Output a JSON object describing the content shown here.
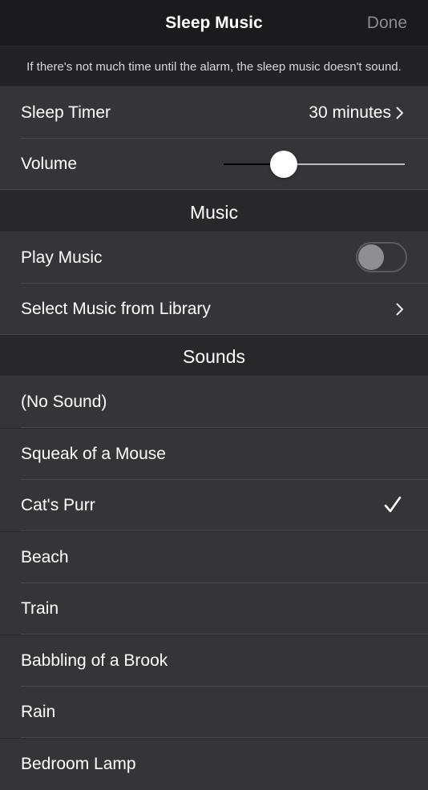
{
  "nav": {
    "title": "Sleep Music",
    "done_label": "Done"
  },
  "notice": "If there's not much time until the alarm, the sleep music doesn't sound.",
  "settings": {
    "sleep_timer_label": "Sleep Timer",
    "sleep_timer_value": "30 minutes",
    "volume_label": "Volume",
    "volume_level": 0.33
  },
  "music": {
    "header": "Music",
    "play_music_label": "Play Music",
    "play_music_on": false,
    "select_library_label": "Select Music from Library"
  },
  "sounds": {
    "header": "Sounds",
    "items": [
      {
        "label": "(No Sound)",
        "selected": false
      },
      {
        "label": "Squeak of a Mouse",
        "selected": false
      },
      {
        "label": "Cat's Purr",
        "selected": true
      },
      {
        "label": "Beach",
        "selected": false
      },
      {
        "label": "Train",
        "selected": false
      },
      {
        "label": "Babbling of a Brook",
        "selected": false
      },
      {
        "label": "Rain",
        "selected": false
      },
      {
        "label": "Bedroom Lamp",
        "selected": false
      }
    ]
  },
  "colors": {
    "nav_background": "#1b1b1d",
    "row_background": "#353539",
    "section_background": "#28282b",
    "done_text": "#8b8b90"
  }
}
